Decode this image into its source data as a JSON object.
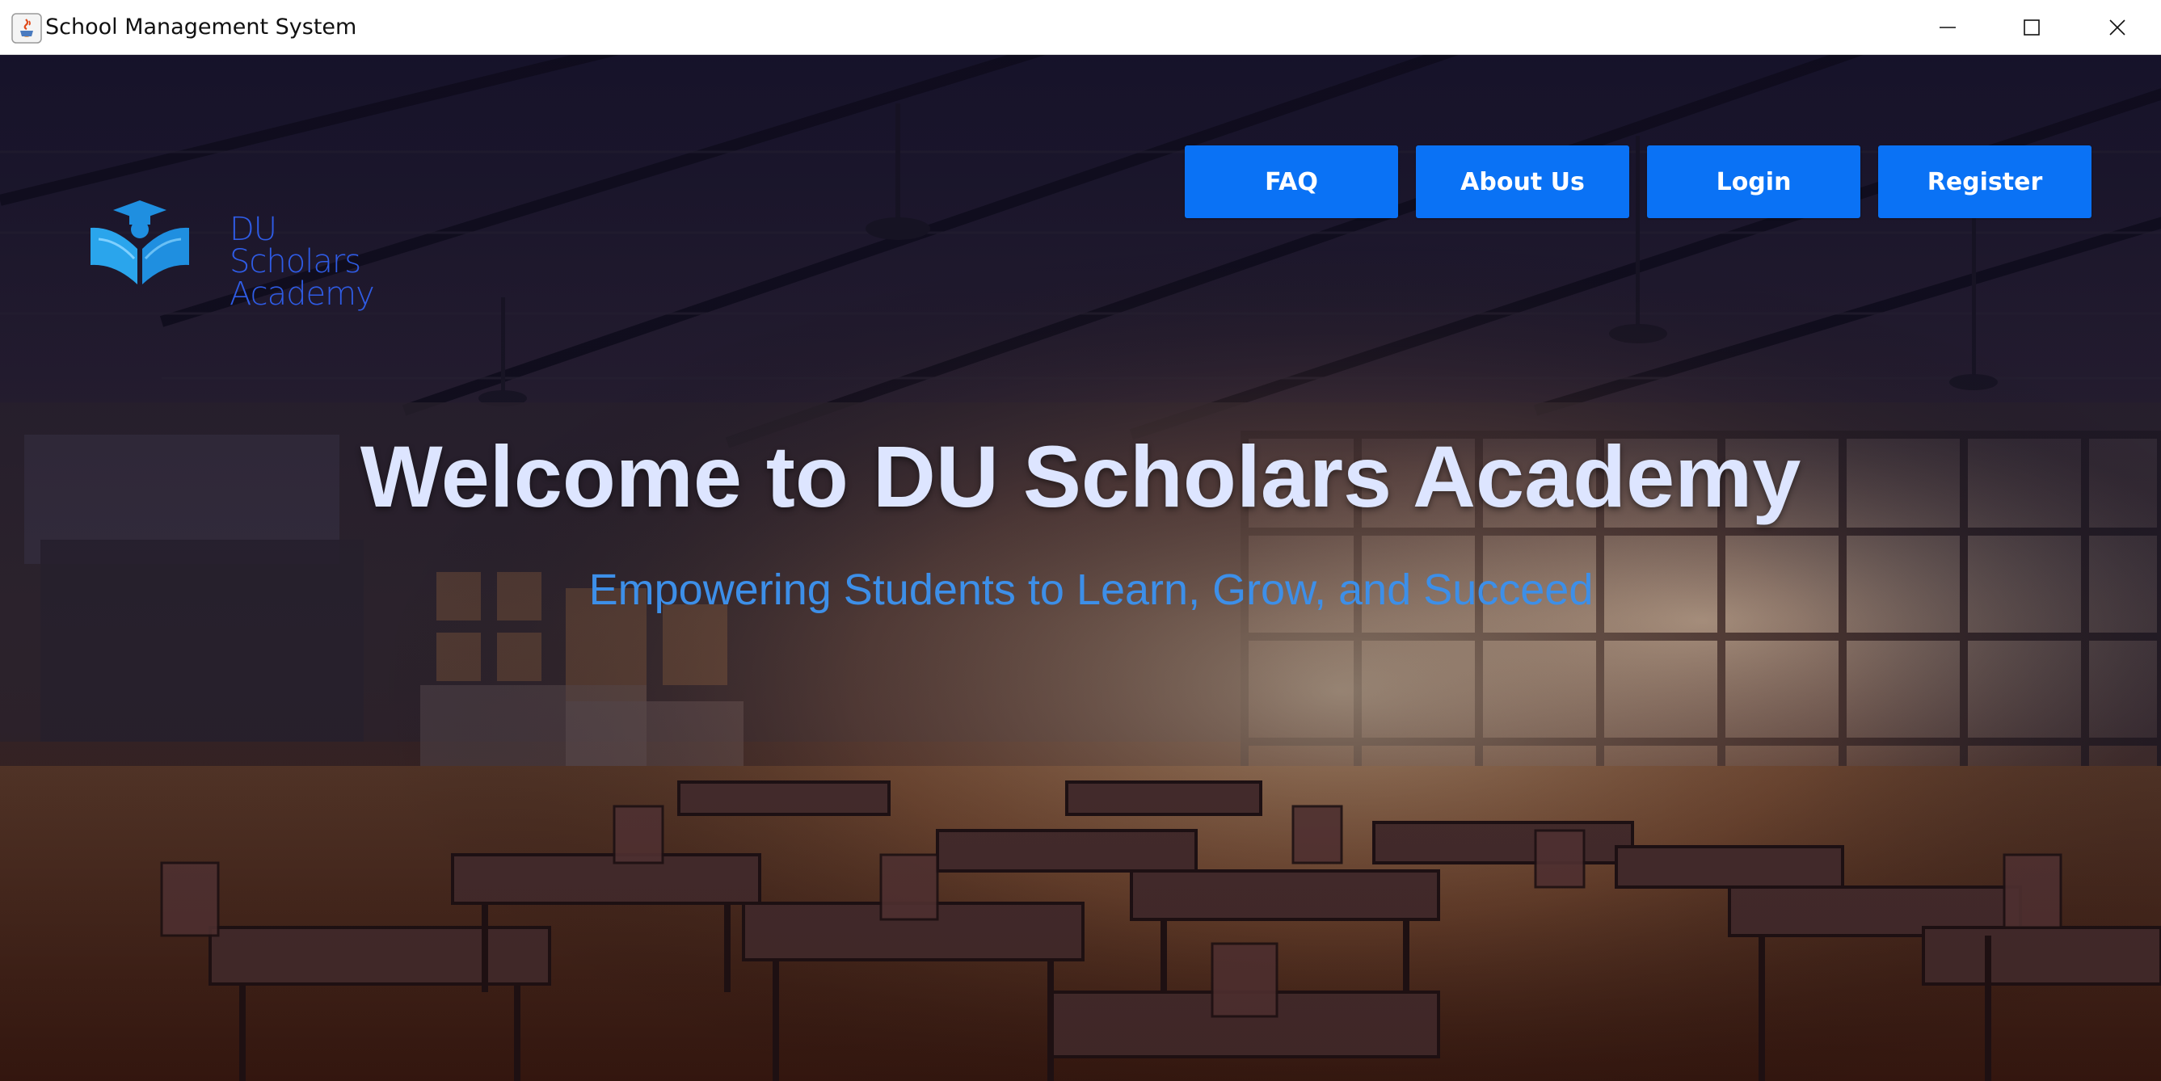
{
  "window": {
    "title": "School Management System",
    "controls": [
      "minimize-icon",
      "maximize-icon",
      "close-icon"
    ]
  },
  "logo": {
    "icon": "graduation-book-icon",
    "lines": [
      "DU",
      "Scholars",
      "Academy"
    ]
  },
  "nav": {
    "faq_label": "FAQ",
    "about_label": "About Us",
    "login_label": "Login",
    "register_label": "Register"
  },
  "hero": {
    "title": "Welcome to DU Scholars Academy",
    "subtitle": "Empowering Students to Learn, Grow, and Succeed"
  },
  "colors": {
    "nav_button": "#0a72f5",
    "logo_text": "#2f5ce6",
    "hero_title": "#dde5ff",
    "hero_subtitle": "#3d8fe8"
  }
}
